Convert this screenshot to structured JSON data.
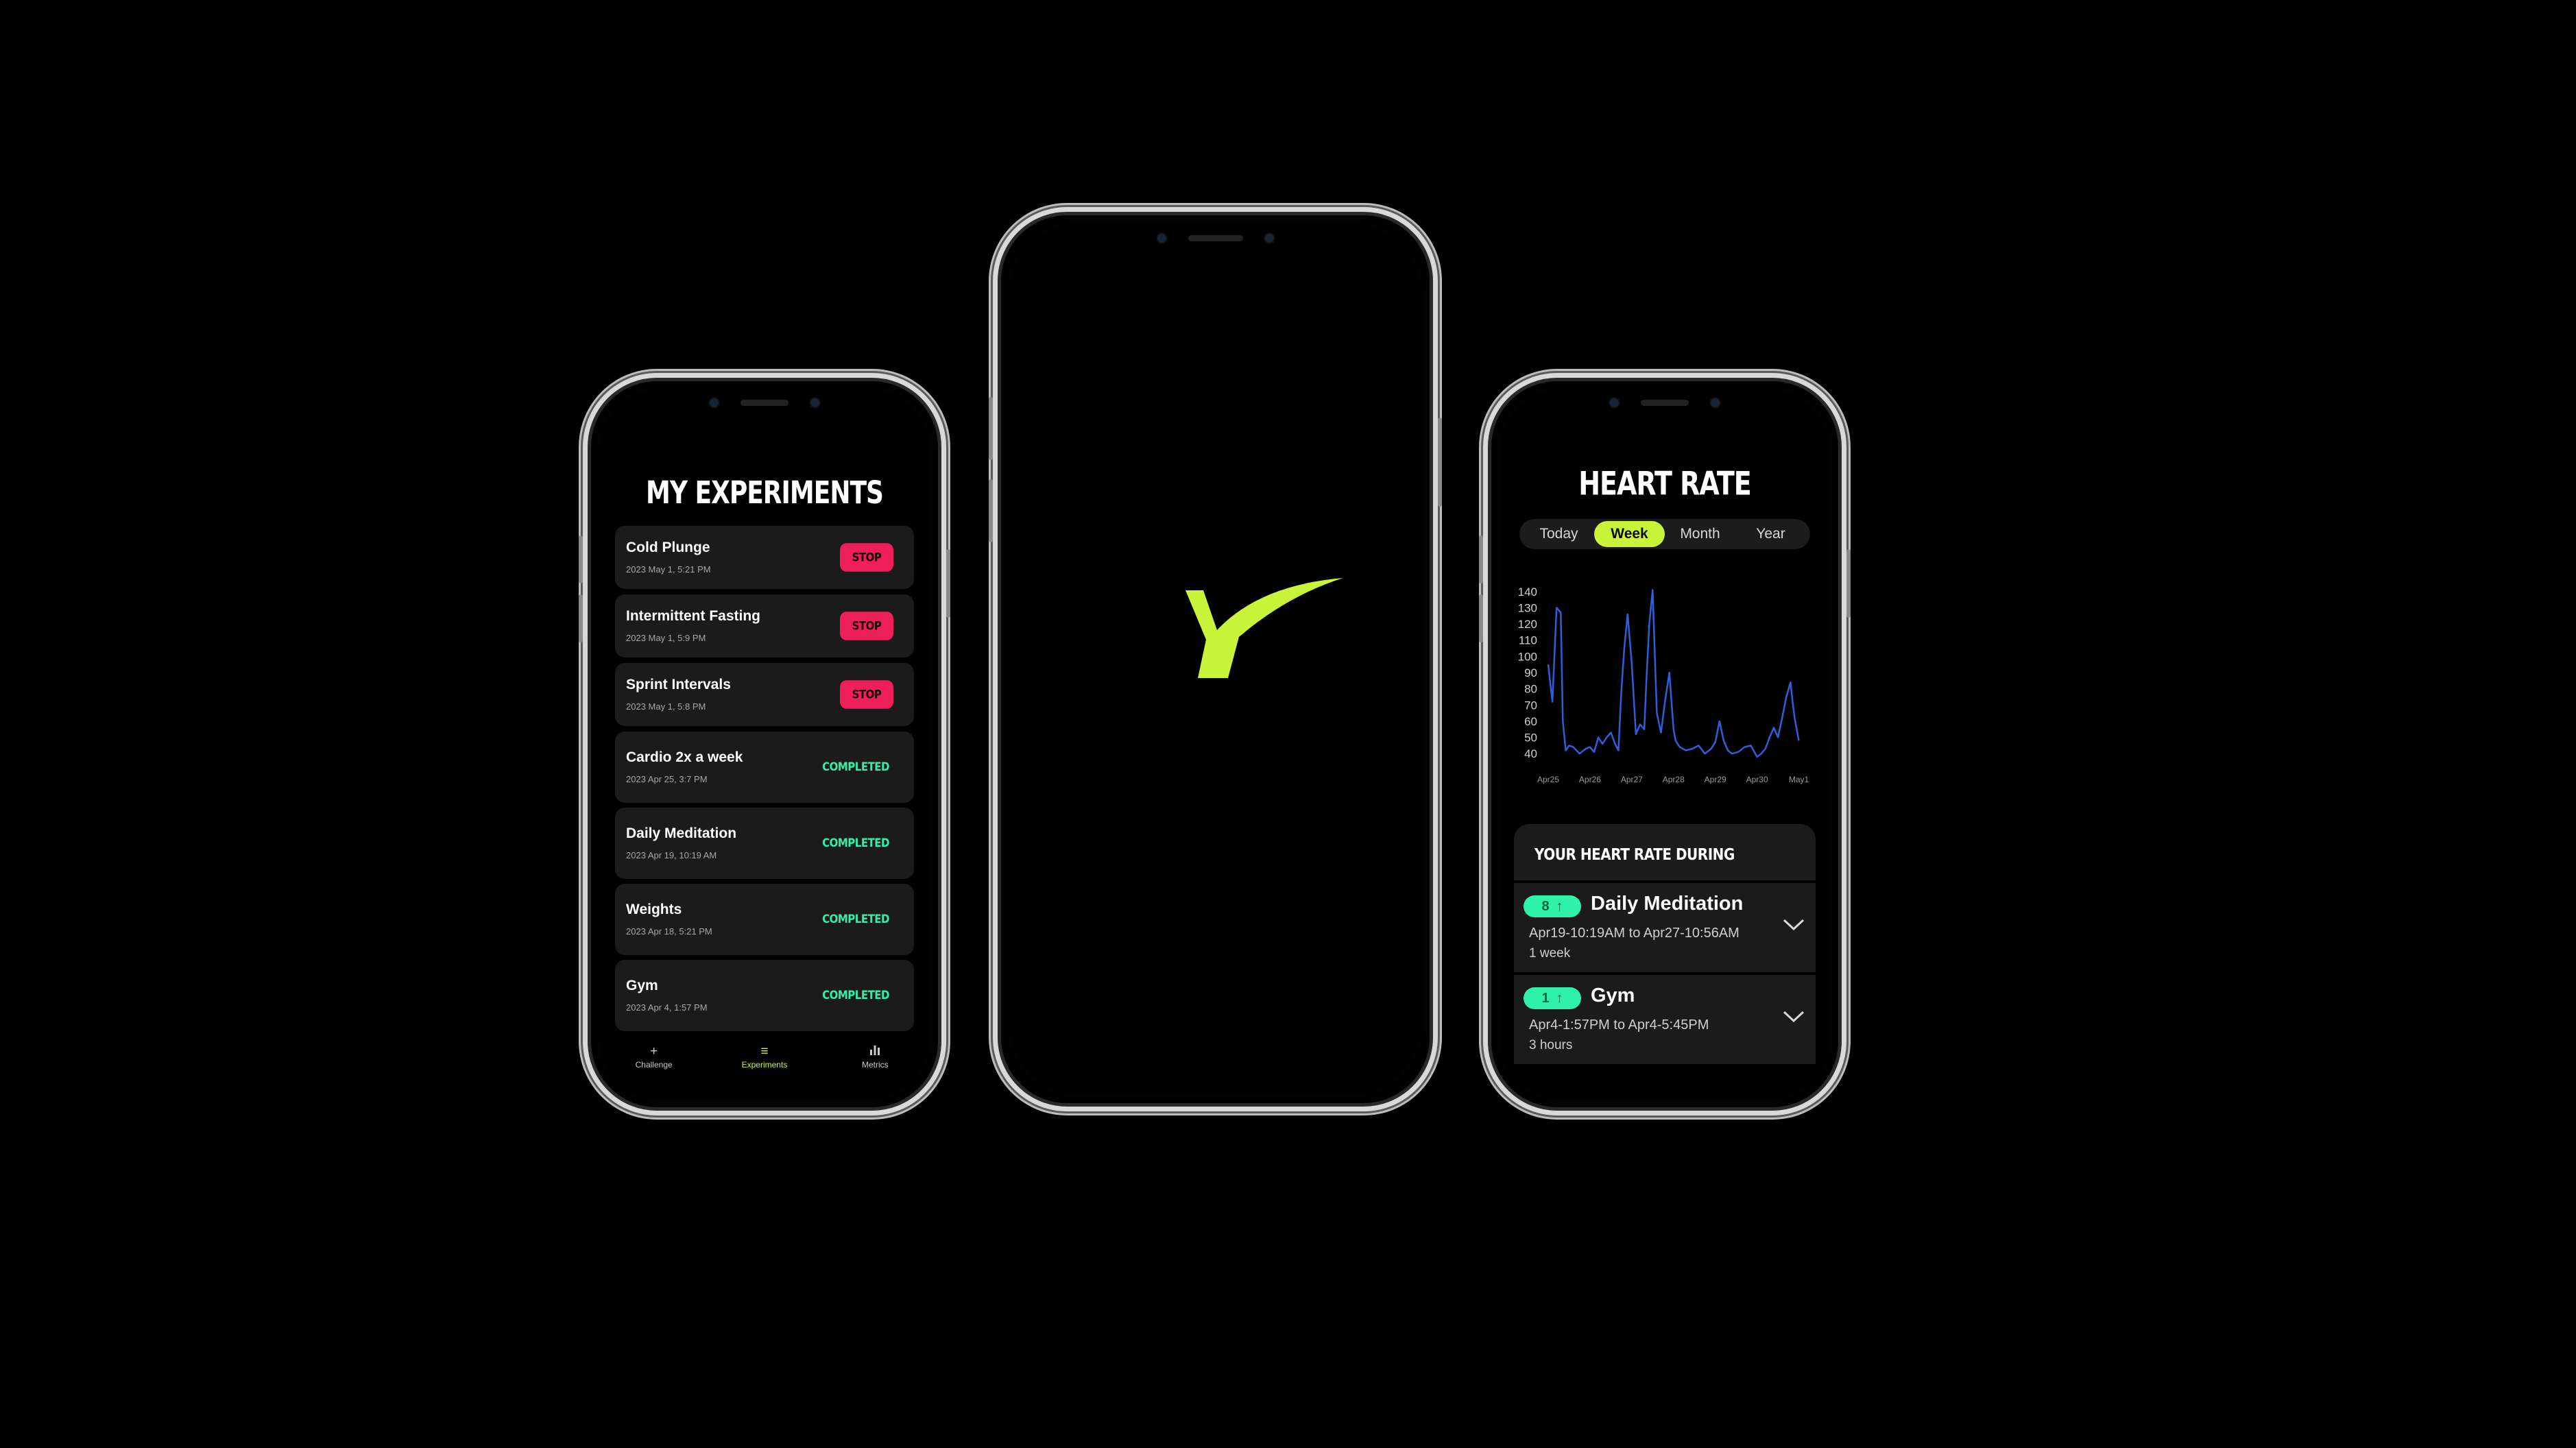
{
  "experiments": {
    "title": "MY EXPERIMENTS",
    "items": [
      {
        "name": "Cold Plunge",
        "date": "2023 May 1,  5:21 PM",
        "action": "STOP"
      },
      {
        "name": "Intermittent Fasting",
        "date": "2023 May 1,  5:9 PM",
        "action": "STOP"
      },
      {
        "name": "Sprint Intervals",
        "date": "2023 May 1,  5:8 PM",
        "action": "STOP"
      },
      {
        "name": "Cardio 2x a week",
        "date": "2023 Apr 25,  3:7 PM",
        "status": "COMPLETED"
      },
      {
        "name": "Daily Meditation",
        "date": "2023 Apr 19,  10:19 AM",
        "status": "COMPLETED"
      },
      {
        "name": "Weights",
        "date": "2023 Apr 18,  5:21 PM",
        "status": "COMPLETED"
      },
      {
        "name": "Gym",
        "date": "2023 Apr 4,  1:57 PM",
        "status": "COMPLETED"
      }
    ],
    "tabs": [
      {
        "label": "Challenge",
        "icon": "plus-icon"
      },
      {
        "label": "Experiments",
        "icon": "list-icon"
      },
      {
        "label": "Metrics",
        "icon": "bar-chart-icon"
      }
    ],
    "active_tab": "Experiments"
  },
  "splash": {
    "logo_color": "#c8f53a"
  },
  "heart_rate": {
    "title": "HEART RATE",
    "ranges": [
      "Today",
      "Week",
      "Month",
      "Year"
    ],
    "active_range": "Week",
    "during_title": "YOUR HEART RATE DURING",
    "periods": [
      {
        "count": "8",
        "name": "Daily Meditation",
        "range": "Apr19-10:19AM to Apr27-10:56AM",
        "duration": "1 week"
      },
      {
        "count": "1",
        "name": "Gym",
        "range": "Apr4-1:57PM to Apr4-5:45PM",
        "duration": "3 hours"
      }
    ]
  },
  "colors": {
    "accent": "#c8f53a",
    "stop": "#ef1f59",
    "completed": "#2df2a8",
    "line": "#2f5fd8"
  },
  "chart_data": {
    "type": "line",
    "y_ticks": [
      140,
      130,
      120,
      110,
      100,
      90,
      80,
      70,
      60,
      50,
      40
    ],
    "ylim": [
      35,
      145
    ],
    "x_ticks": [
      "Apr25",
      "Apr26",
      "Apr27",
      "Apr28",
      "Apr29",
      "Apr30",
      "May1"
    ],
    "xlim": [
      0,
      6.5
    ],
    "series": [
      {
        "x": [
          0,
          0.1,
          0.2,
          0.3,
          0.35,
          0.42,
          0.5,
          0.6,
          0.75,
          0.9,
          1.0,
          1.1,
          1.2,
          1.3,
          1.4,
          1.5,
          1.6,
          1.68,
          1.75,
          1.82,
          1.9,
          2.0,
          2.1,
          2.2,
          2.3,
          2.35,
          2.42,
          2.5,
          2.6,
          2.7,
          2.8,
          2.9,
          3.0,
          3.05,
          3.15,
          3.3,
          3.45,
          3.6,
          3.75,
          3.9,
          4.0,
          4.1,
          4.2,
          4.3,
          4.4,
          4.55,
          4.7,
          4.85,
          5.0,
          5.1,
          5.2,
          5.3,
          5.4,
          5.5,
          5.6,
          5.7,
          5.8,
          5.85,
          5.9,
          6.0
        ],
        "y": [
          95,
          72,
          130,
          127,
          60,
          42,
          45,
          44,
          40,
          43,
          44,
          41,
          50,
          46,
          50,
          53,
          46,
          42,
          78,
          105,
          126,
          96,
          52,
          58,
          55,
          85,
          120,
          141,
          65,
          53,
          73,
          90,
          55,
          48,
          44,
          42,
          43,
          45,
          40,
          43,
          47,
          60,
          48,
          42,
          40,
          41,
          44,
          45,
          38,
          40,
          43,
          50,
          56,
          50,
          62,
          75,
          84,
          72,
          62,
          48
        ]
      }
    ]
  }
}
